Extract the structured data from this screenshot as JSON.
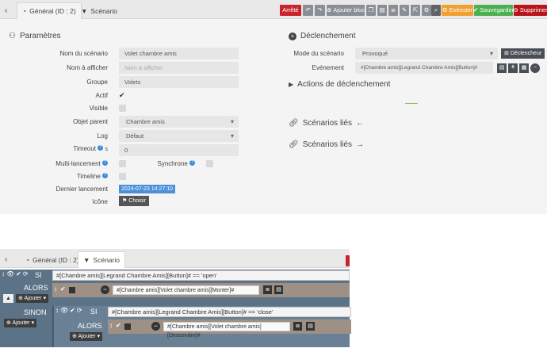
{
  "top": {
    "tabs": [
      {
        "label": "Général (ID : 2)"
      },
      {
        "label": "Scénario"
      }
    ],
    "toolbar": {
      "state": "Arrêté",
      "add_block": "Ajouter bloc",
      "execute": "Exécuter",
      "save": "Sauvegarder",
      "delete": "Supprimer"
    },
    "params": {
      "title": "Paramètres",
      "name_label": "Nom du scénario",
      "name_value": "Volet chambre amis",
      "display_label": "Nom à afficher",
      "display_placeholder": "Nom à afficher",
      "group_label": "Groupe",
      "group_value": "Volets",
      "active_label": "Actif",
      "visible_label": "Visible",
      "parent_label": "Objet parent",
      "parent_value": "Chambre amis",
      "log_label": "Log",
      "log_value": "Défaut",
      "timeout_label": "Timeout",
      "timeout_unit": "s",
      "timeout_value": "0",
      "multi_label": "Multi-lancement",
      "sync_label": "Synchrone",
      "timeline_label": "Timeline",
      "last_run_label": "Dernier lancement",
      "last_run_value": "2024-07-23 14:27:10",
      "icon_label": "Icône",
      "choose_label": "Choisir"
    },
    "trigger": {
      "title": "Déclenchement",
      "mode_label": "Mode du scénario",
      "mode_value": "Provoqué",
      "trigger_button": "Déclencheur",
      "event_label": "Evénement",
      "event_value": "#[Chambre amis][Legrand Chambre Amis][Button]#",
      "actions_title": "Actions de déclenchement",
      "linked_in": "Scénarios liés",
      "linked_out": "Scénarios liés"
    }
  },
  "bottom": {
    "tabs": [
      {
        "label": "Général (ID : 2)"
      },
      {
        "label": "Scénario"
      }
    ],
    "si_label": "SI",
    "alors_label": "ALORS",
    "sinon_label": "SINON",
    "add_label": "Ajouter",
    "condition1": "#[Chambre amis][Legrand Chambre Amis][Button]# == 'open'",
    "action1": "#[Chambre amis][Volet chambre amis][Monter]#",
    "condition2": "#[Chambre amis][Legrand Chambre Amis][Button]# == 'close'",
    "action2": "#[Chambre amis][Volet chambre amis][Descendre]#"
  }
}
